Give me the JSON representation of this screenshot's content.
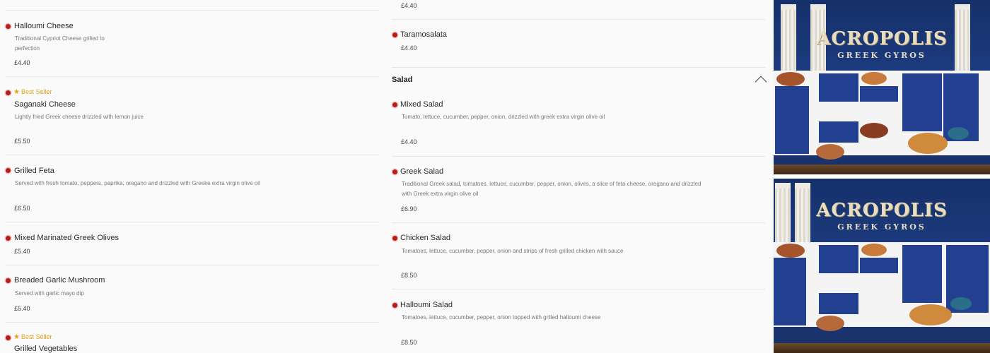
{
  "left_items": [
    {
      "name": "Halloumi Cheese",
      "desc": "Traditional Cypriot Cheese grilled to perfection",
      "price": "£4.40",
      "badge": ""
    },
    {
      "name": "Saganaki Cheese",
      "desc": "Lightly fried Greek cheese drizzled with lemon juice",
      "price": "£5.50",
      "badge": "Best Seller"
    },
    {
      "name": "Grilled Feta",
      "desc": "Served with fresh tomato, peppers, paprika, oregano and drizzled with Greeke extra virgin olive oil",
      "price": "£6.50",
      "badge": ""
    },
    {
      "name": "Mixed Marinated Greek Olives",
      "desc": "",
      "price": "£5.40",
      "badge": ""
    },
    {
      "name": "Breaded Garlic Mushroom",
      "desc": "Served with garlic mayo dip",
      "price": "£5.40",
      "badge": ""
    },
    {
      "name": "Grilled Vegetables",
      "desc": "",
      "price": "",
      "badge": "Best Seller"
    }
  ],
  "right_top_items": [
    {
      "name": "",
      "price": "£4.40"
    },
    {
      "name": "Taramosalata",
      "price": "£4.40"
    }
  ],
  "salad_section": {
    "title": "Salad",
    "items": [
      {
        "name": "Mixed Salad",
        "desc": "Tomato, lettuce, cucumber, pepper, onion, drizzled with greek extra virgin olive oil",
        "price": "£4.40"
      },
      {
        "name": "Greek Salad",
        "desc": "Traditional Greek salad, tomatoes, lettuce, cucumber, pepper, onion, olives, a slice of feta cheese, oregano and drizzled with Greek extra virgin olive oil",
        "price": "£6.90"
      },
      {
        "name": "Chicken Salad",
        "desc": "Tomatoes, lettuce, cucumber, pepper, onion and strips of fresh grilled chicken with sauce",
        "price": "£8.50"
      },
      {
        "name": "Halloumi Salad",
        "desc": "Tomatoes, lettuce, cucumber, pepper, onion topped with grilled halloumi cheese",
        "price": "£8.50"
      }
    ]
  },
  "photos": {
    "logo_title": "ACROPOLIS",
    "logo_subtitle": "GREEK GYROS"
  },
  "colors": {
    "accent_dot": "#b71c1c",
    "badge": "#e3a21a",
    "board_blue": "#233f90"
  },
  "icons": {
    "item_marker": "red-dot-icon",
    "best_seller": "star-icon",
    "collapse": "chevron-up-icon"
  }
}
